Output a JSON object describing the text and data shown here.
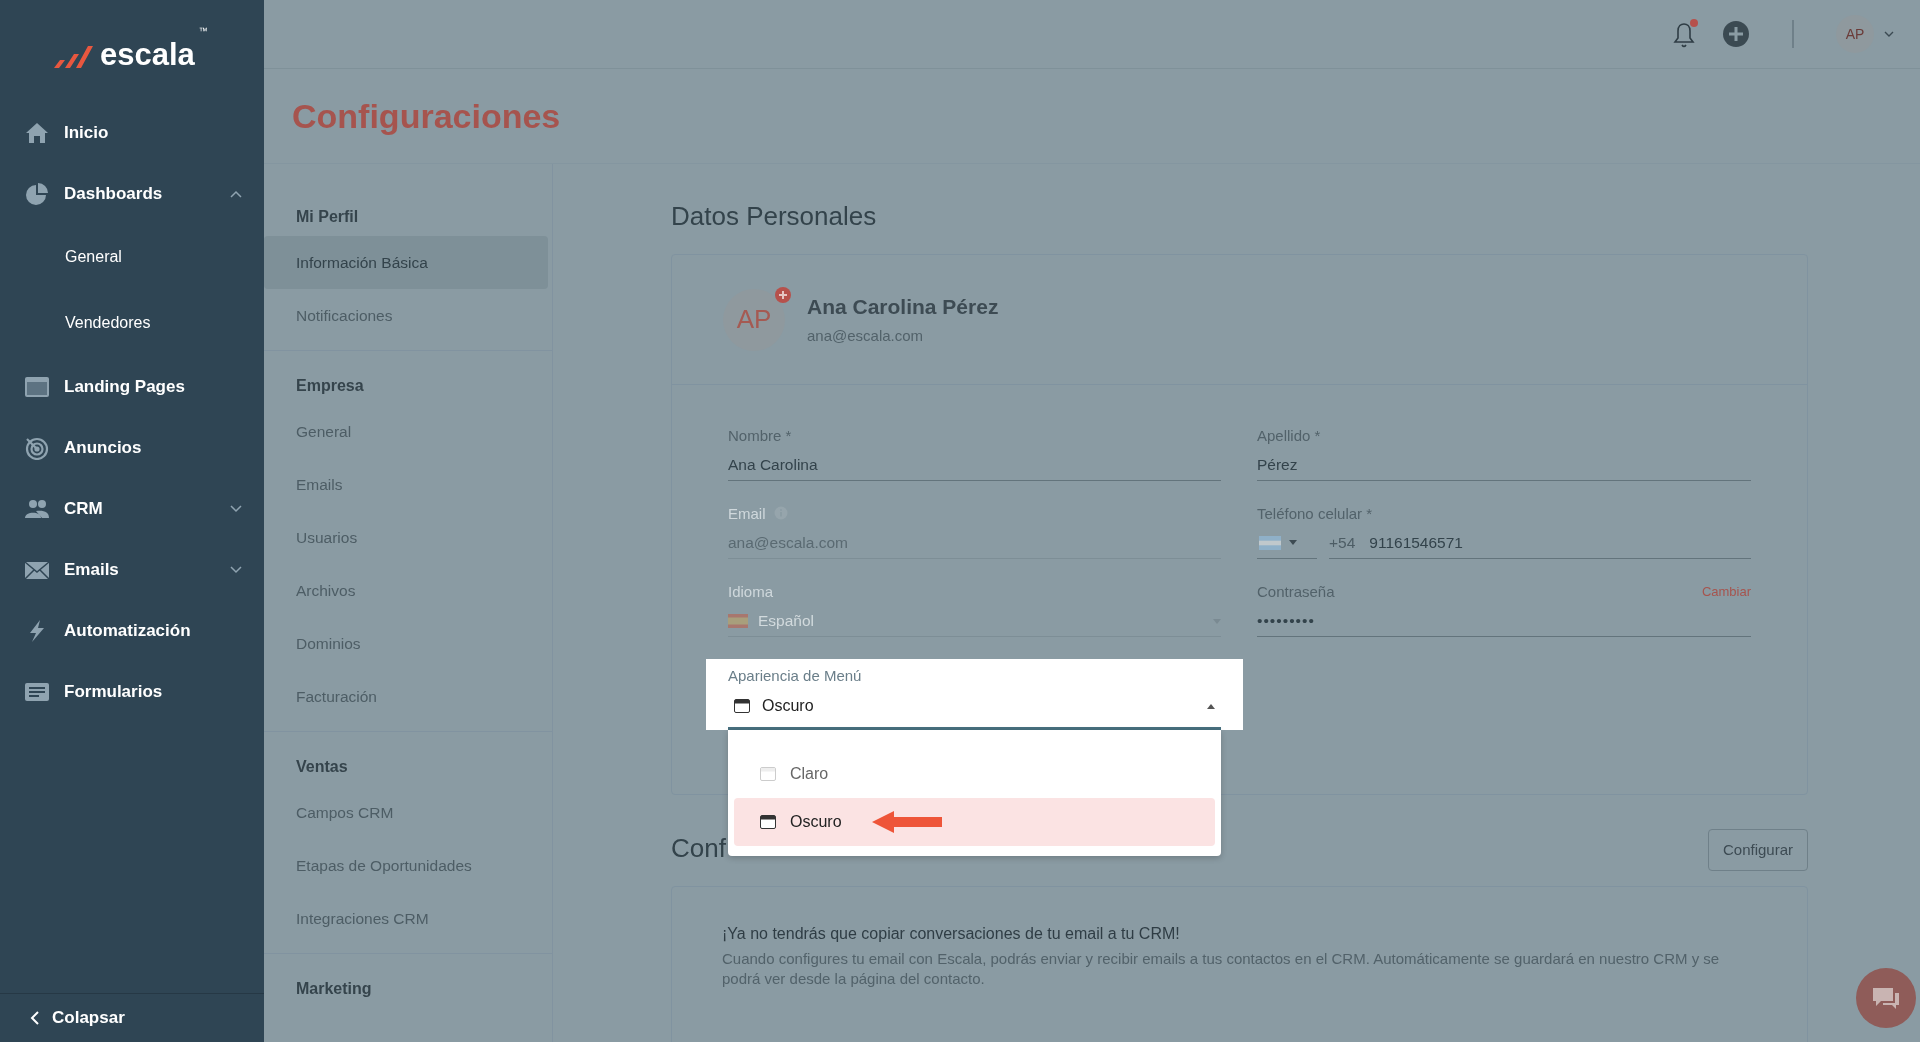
{
  "sidebar": {
    "logo": "escala",
    "logo_mark": "™",
    "items": [
      {
        "label": "Inicio"
      },
      {
        "label": "Dashboards",
        "expanded": true,
        "children": [
          {
            "label": "General"
          },
          {
            "label": "Vendedores"
          }
        ]
      },
      {
        "label": "Landing Pages"
      },
      {
        "label": "Anuncios"
      },
      {
        "label": "CRM",
        "expanded": false
      },
      {
        "label": "Emails",
        "expanded": false
      },
      {
        "label": "Automatización"
      },
      {
        "label": "Formularios"
      }
    ],
    "collapse": "Colapsar"
  },
  "header": {
    "has_notification": true,
    "avatar": "AP"
  },
  "page_title": "Configuraciones",
  "settings_nav": [
    {
      "heading": "Mi Perfil",
      "items": [
        {
          "label": "Información Básica",
          "selected": true
        },
        {
          "label": "Notificaciones",
          "selected": false
        }
      ]
    },
    {
      "heading": "Empresa",
      "items": [
        {
          "label": "General",
          "selected": false
        },
        {
          "label": "Emails",
          "selected": false
        },
        {
          "label": "Usuarios",
          "selected": false
        },
        {
          "label": "Archivos",
          "selected": false
        },
        {
          "label": "Dominios",
          "selected": false
        },
        {
          "label": "Facturación",
          "selected": false
        }
      ]
    },
    {
      "heading": "Ventas",
      "items": [
        {
          "label": "Campos CRM",
          "selected": false
        },
        {
          "label": "Etapas de Oportunidades",
          "selected": false
        },
        {
          "label": "Integraciones CRM",
          "selected": false
        }
      ]
    },
    {
      "heading": "Marketing"
    }
  ],
  "personal": {
    "title": "Datos Personales",
    "profile": {
      "initials": "AP",
      "name": "Ana Carolina Pérez",
      "email": "ana@escala.com"
    },
    "fields": [
      {
        "kind": "text",
        "label": "Nombre *",
        "value": "Ana Carolina",
        "disabled": false
      },
      {
        "kind": "text",
        "label": "Apellido *",
        "value": "Pérez",
        "disabled": false
      },
      {
        "kind": "text",
        "label": "Email",
        "value": "ana@escala.com",
        "disabled": true
      },
      {
        "kind": "phone",
        "label": "Teléfono celular *",
        "code": "+54",
        "value": "91161546571",
        "disabled": false
      },
      {
        "kind": "select",
        "label": "Idioma",
        "value": "Español",
        "disabled": true
      },
      {
        "kind": "password",
        "label": "Contraseña",
        "value": "•••••••••",
        "action": "Cambiar",
        "disabled": false
      }
    ],
    "menu_appearance": {
      "label": "Apariencia de Menú",
      "value": "Oscuro",
      "expanded": true,
      "options": [
        {
          "label": "Claro",
          "selected": false
        },
        {
          "label": "Oscuro",
          "selected": true
        }
      ]
    }
  },
  "email_section": {
    "title": "Conf",
    "button": "Configurar",
    "headline": "¡Ya no tendrás que copiar conversaciones de tu email a tu CRM!",
    "body": "Cuando configures tu email con Escala, podrás enviar y recibir emails a tus contactos en el CRM. Automáticamente se guardará en nuestro CRM y se podrá ver desde la página del contacto."
  }
}
